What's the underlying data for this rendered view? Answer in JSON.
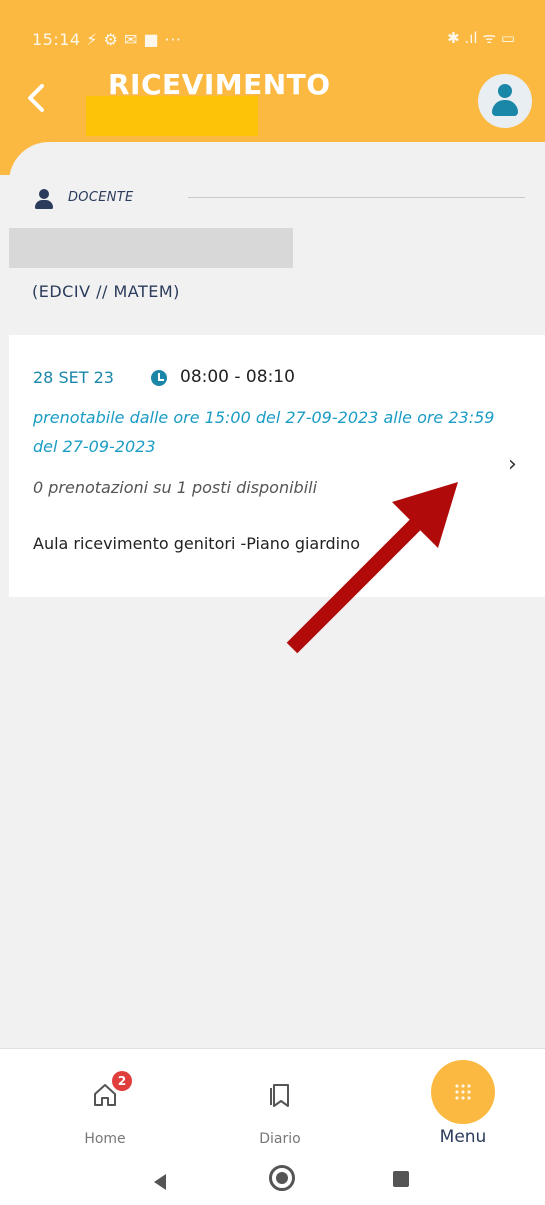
{
  "status_bar": {
    "time": "15:14",
    "left_icons": "⚡ ⚙ ✉ ■ ···",
    "right_icons": "✱ .ıl ᯤ ▭"
  },
  "header": {
    "title": "RICEVIMENTO",
    "back_icon": "chevron-left-icon",
    "profile_icon": "user-icon",
    "accent_color": "#fbb941"
  },
  "teacher": {
    "section_label": "DOCENTE",
    "subjects": "(EDCIV // MATEM)"
  },
  "slot": {
    "date": "28 SET 23",
    "time": "08:00 - 08:10",
    "bookable": "prenotabile dalle ore 15:00 del 27-09-2023 alle ore 23:59 del 27-09-2023",
    "seats": "0 prenotazioni su 1 posti disponibili",
    "room": "Aula ricevimento genitori -Piano giardino",
    "chevron": "›"
  },
  "bottom_nav": {
    "items": [
      {
        "label": "Home",
        "icon": "home-icon",
        "badge": "2"
      },
      {
        "label": "Diario",
        "icon": "bookmark-icon"
      },
      {
        "label": "Menu",
        "icon": "grid-dots-icon"
      }
    ]
  },
  "colors": {
    "teal": "#1a87a9",
    "navy": "#2b3b5c",
    "badge_red": "#e03d3d",
    "arrow_red": "#b00a0a"
  }
}
